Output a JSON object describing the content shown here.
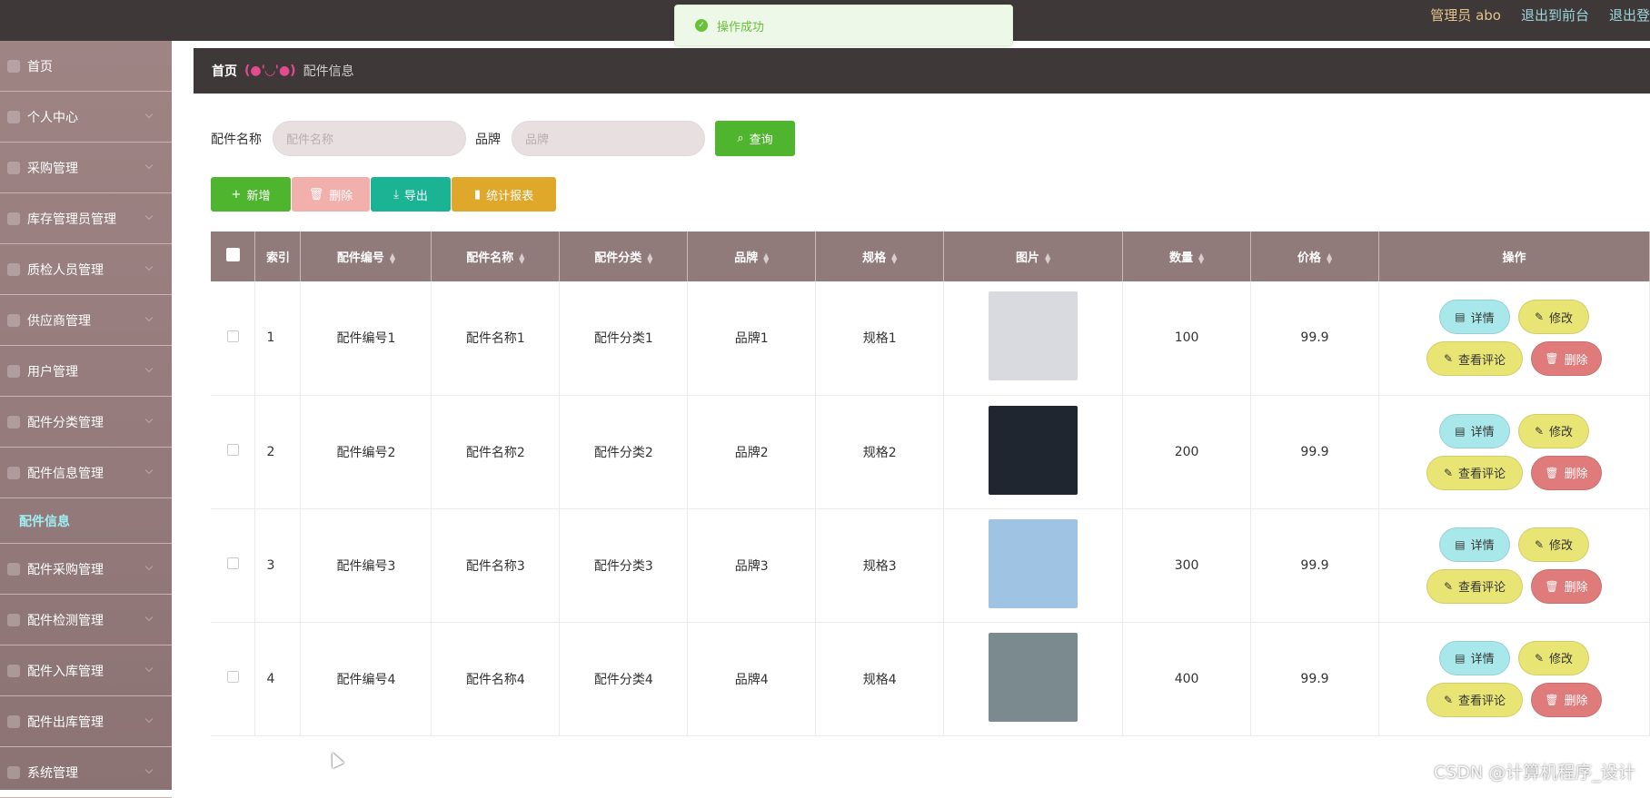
{
  "topbar": {
    "admin": "管理员 abo",
    "to_front": "退出到前台",
    "logout": "退出登"
  },
  "toast": {
    "text": "操作成功"
  },
  "sidebar": {
    "items": [
      {
        "label": "首页",
        "icon": "home-icon"
      },
      {
        "label": "个人中心",
        "icon": "user-icon"
      },
      {
        "label": "采购管理",
        "icon": "plane-icon"
      },
      {
        "label": "库存管理员管理",
        "icon": "grid-icon"
      },
      {
        "label": "质检人员管理",
        "icon": "shield-icon"
      },
      {
        "label": "供应商管理",
        "icon": "gear-icon"
      },
      {
        "label": "用户管理",
        "icon": "bar-icon"
      },
      {
        "label": "配件分类管理",
        "icon": "list-icon"
      },
      {
        "label": "配件信息管理",
        "icon": "doc-icon"
      }
    ],
    "active_sub": "配件信息",
    "items_after": [
      {
        "label": "配件采购管理",
        "icon": "list-icon"
      },
      {
        "label": "配件检测管理",
        "icon": "grid-icon"
      },
      {
        "label": "配件入库管理",
        "icon": "user-icon"
      },
      {
        "label": "配件出库管理",
        "icon": "pin-icon"
      },
      {
        "label": "系统管理",
        "icon": "gear-icon"
      }
    ]
  },
  "breadcrumb": {
    "home": "首页",
    "face": "(●'◡'●)",
    "current": "配件信息"
  },
  "search": {
    "name_label": "配件名称",
    "name_placeholder": "配件名称",
    "brand_label": "品牌",
    "brand_placeholder": "品牌",
    "query_label": "查询"
  },
  "actions": {
    "add": "新增",
    "delete": "删除",
    "export": "导出",
    "stats": "统计报表"
  },
  "table": {
    "headers": [
      "索引",
      "配件编号",
      "配件名称",
      "配件分类",
      "品牌",
      "规格",
      "图片",
      "数量",
      "价格",
      "操作"
    ],
    "rows": [
      {
        "idx": "1",
        "code": "配件编号1",
        "name": "配件名称1",
        "cat": "配件分类1",
        "brand": "品牌1",
        "spec": "规格1",
        "qty": "100",
        "price": "99.9",
        "img_color": "#d9d9e0"
      },
      {
        "idx": "2",
        "code": "配件编号2",
        "name": "配件名称2",
        "cat": "配件分类2",
        "brand": "品牌2",
        "spec": "规格2",
        "qty": "200",
        "price": "99.9",
        "img_color": "#1f2630"
      },
      {
        "idx": "3",
        "code": "配件编号3",
        "name": "配件名称3",
        "cat": "配件分类3",
        "brand": "品牌3",
        "spec": "规格3",
        "qty": "300",
        "price": "99.9",
        "img_color": "#9fc4e3"
      },
      {
        "idx": "4",
        "code": "配件编号4",
        "name": "配件名称4",
        "cat": "配件分类4",
        "brand": "品牌4",
        "spec": "规格4",
        "qty": "400",
        "price": "99.9",
        "img_color": "#7b8a8f"
      }
    ],
    "row_actions": {
      "detail": "详情",
      "edit": "修改",
      "review": "查看评论",
      "delete": "删除"
    }
  },
  "watermark": "CSDN @计算机程序_设计"
}
